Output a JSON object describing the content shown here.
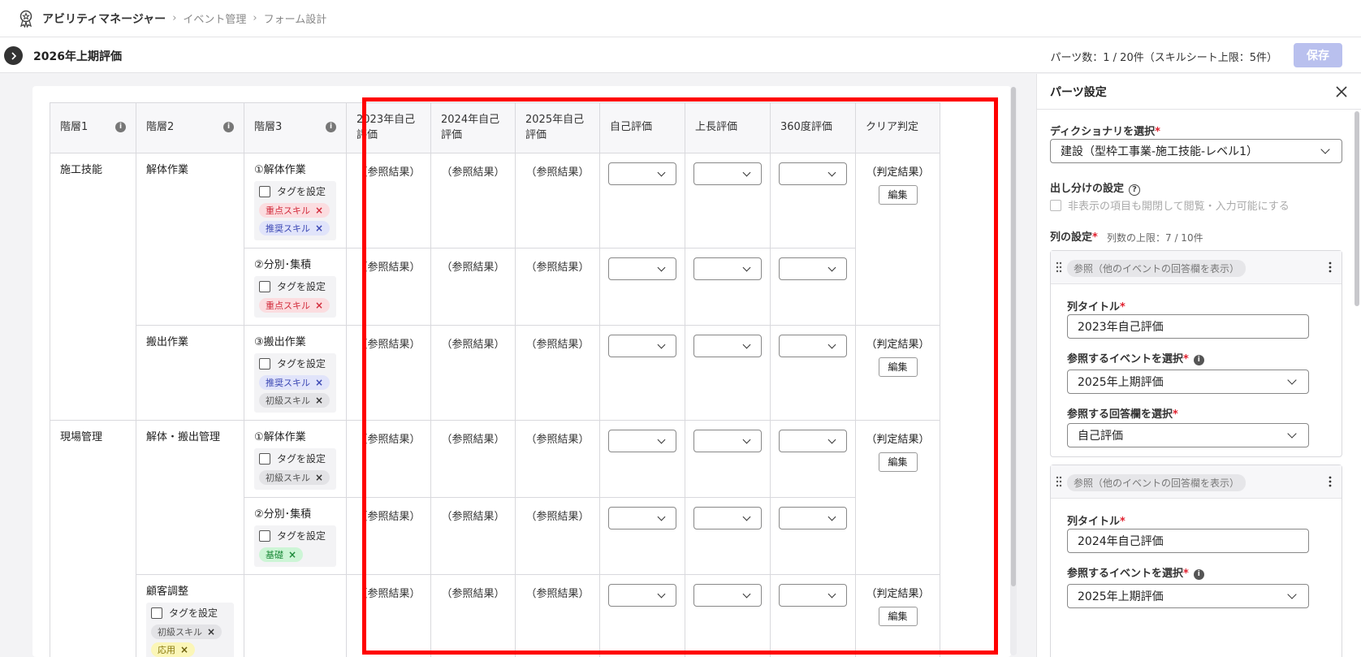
{
  "header": {
    "app_name": "アビリティマネージャー",
    "breadcrumbs": [
      "イベント管理",
      "フォーム設計"
    ]
  },
  "subheader": {
    "page_title": "2026年上期評価",
    "parts_count": "パーツ数：1 / 20件（スキルシート上限：5件）",
    "save_label": "保存"
  },
  "table": {
    "columns": [
      "階層1",
      "階層2",
      "階層3",
      "2023年自己評価",
      "2024年自己評価",
      "2025年自己評価",
      "自己評価",
      "上長評価",
      "360度評価",
      "クリア判定"
    ],
    "ref_text": "（参照結果）",
    "judge_text": "（判定結果）",
    "edit_label": "編集",
    "tag_set_label": "タグを設定",
    "rows": [
      {
        "l1": "施工技能",
        "l2": "解体作業",
        "item": "①解体作業",
        "tags": [
          "重点スキル",
          "推奨スキル"
        ]
      },
      {
        "item": "②分別･集積",
        "tags": [
          "重点スキル"
        ]
      },
      {
        "l2": "搬出作業",
        "item": "③搬出作業",
        "tags": [
          "推奨スキル",
          "初級スキル"
        ]
      },
      {
        "l1": "現場管理",
        "l2": "解体・搬出管理",
        "item": "①解体作業",
        "tags": [
          "初級スキル"
        ]
      },
      {
        "item": "②分別･集積",
        "tags": [
          "基礎"
        ]
      },
      {
        "l2": "顧客調整",
        "tags": [
          "初級スキル",
          "応用"
        ]
      }
    ]
  },
  "panel": {
    "title": "パーツ設定",
    "dictionary_label": "ディクショナリを選択",
    "dictionary_value": "建設（型枠工事業-施工技能-レベル1）",
    "display_label": "出し分けの設定",
    "display_checkbox": "非表示の項目も開閉して閲覧・入力可能にする",
    "columns_label": "列の設定",
    "columns_limit": "列数の上限：7 / 10件",
    "ref_pill": "参照（他のイベントの回答欄を表示）",
    "col_title_label": "列タイトル",
    "event_label": "参照するイベントを選択",
    "answer_label": "参照する回答欄を選択",
    "cards": [
      {
        "title": "2023年自己評価",
        "event": "2025年上期評価",
        "answer": "自己評価"
      },
      {
        "title": "2024年自己評価",
        "event": "2025年上期評価"
      }
    ]
  },
  "colors": {
    "accent_disabled": "#b9c0ee",
    "highlight": "#ff0000",
    "required": "#e0202e"
  }
}
